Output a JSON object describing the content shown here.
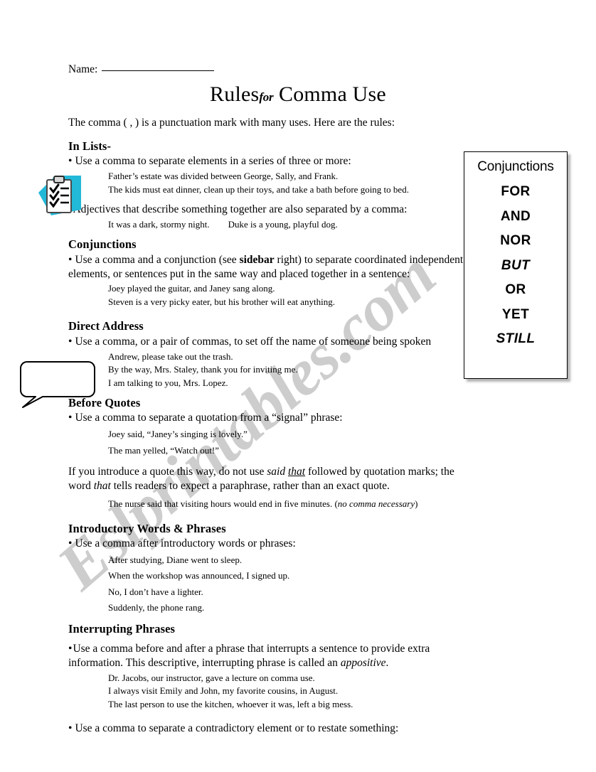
{
  "worksheet": {
    "name_label": "Name:",
    "title_main_1": "Rules",
    "title_for": "for",
    "title_main_2": "Comma Use",
    "intro": "The comma ( ‚ ) is a punctuation mark with many uses. Here are the rules:",
    "watermark": "Eslprintables.com"
  },
  "icons": {
    "clipboard": "clipboard-checklist-icon",
    "speech_bubble": "speech-bubble-icon"
  },
  "sidebar": {
    "title": "Conjunctions",
    "items": [
      {
        "label": "FOR",
        "italic": false
      },
      {
        "label": "AND",
        "italic": false
      },
      {
        "label": "NOR",
        "italic": false
      },
      {
        "label": "BUT",
        "italic": true
      },
      {
        "label": "OR",
        "italic": false
      },
      {
        "label": "YET",
        "italic": false
      },
      {
        "label": "STILL",
        "italic": true
      }
    ]
  },
  "sections": {
    "lists": {
      "heading": "In Lists-",
      "bullet1": "Use a comma to separate elements in a series of three or more:",
      "examples1": [
        "Father’s estate was divided between George, Sally, and Frank.",
        "The kids must eat dinner, clean up their toys, and take a bath before going to bed."
      ],
      "bullet2": "Adjectives that describe something together are also separated by a comma:",
      "examples2": [
        "It was a dark, stormy night.        Duke is a young, playful dog."
      ]
    },
    "conjunctions": {
      "heading": "Conjunctions",
      "bullet_part1": "Use a comma and a conjunction (see ",
      "bullet_bold": "sidebar",
      "bullet_part2": " right) to separate coordinated independent elements, or sentences put in the same way and placed together in a sentence:",
      "examples": [
        "Joey played the guitar, and Janey sang along.",
        "Steven is a very picky eater, but his brother will eat anything."
      ]
    },
    "direct_address": {
      "heading": "Direct Address",
      "bullet": "Use a comma, or a pair of commas, to set off the name of someone being spoken",
      "examples": [
        "Andrew, please take out the trash.",
        "By the way, Mrs. Staley, thank you for inviting me.",
        "I am talking to you, Mrs. Lopez."
      ]
    },
    "before_quotes": {
      "heading": "Before Quotes",
      "bullet": "Use a comma to separate a quotation from a “signal” phrase:",
      "examples": [
        "Joey said, “Janey’s singing is lovely.”",
        "The man yelled, “Watch out!”"
      ],
      "para_part1": "If you introduce a quote this way, do not use ",
      "para_italic1": "said ",
      "para_italic_underline": "that",
      "para_part2": " followed by quotation marks; the word ",
      "para_italic2": "that",
      "para_part3": " tells readers to expect a paraphrase, rather than an exact quote.",
      "example_note_text": "The nurse said that visiting hours would end in five minutes. (",
      "example_note_italic": "no comma necessary",
      "example_note_end": ")"
    },
    "introductory": {
      "heading": "Introductory Words & Phrases",
      "bullet": "Use a comma after introductory words or phrases:",
      "examples": [
        "After studying, Diane went to sleep.",
        "When the workshop was announced, I signed up.",
        "No, I don’t have a lighter.",
        "Suddenly, the phone rang."
      ]
    },
    "interrupting": {
      "heading": "Interrupting Phrases",
      "bullet_part1": "Use a comma before and after a phrase that interrupts a sentence to provide extra information. This descriptive, interrupting phrase is called an ",
      "bullet_italic": "appositive",
      "bullet_part2": ".",
      "examples": [
        "Dr. Jacobs, our instructor, gave a lecture on comma use.",
        "I always visit Emily and John, my favorite cousins, in August.",
        "The last person to use the kitchen, whoever it was, left a big mess."
      ],
      "bullet_last": "Use a comma to separate a contradictory element or to restate something:"
    }
  },
  "colors": {
    "clipboard_accent": "#22b8d8",
    "text": "#000000",
    "watermark": "#828282"
  }
}
